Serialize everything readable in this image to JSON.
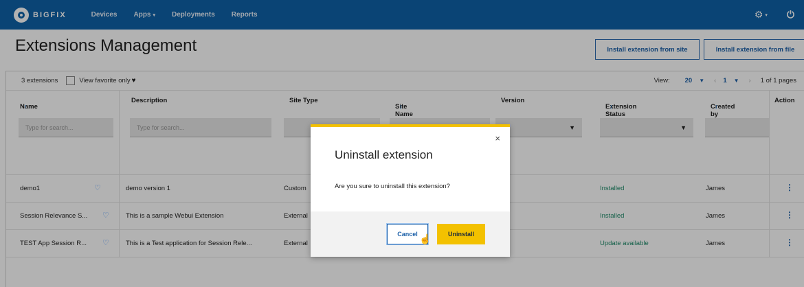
{
  "nav": {
    "brand": "BIGFIX",
    "items": [
      "Devices",
      "Apps",
      "Deployments",
      "Reports"
    ],
    "apps_caret": "▾",
    "gear_caret": "▾"
  },
  "page": {
    "title": "Extensions Management",
    "install_site_label": "Install extension from site",
    "install_file_label": "Install extension from file"
  },
  "toolbar": {
    "count": "3 extensions",
    "favorite_label": "View favorite only",
    "view_label": "View:",
    "view_value": "20",
    "page_value": "1",
    "pages_label": "1 of 1 pages"
  },
  "columns": [
    "Name",
    "Description",
    "Site Type",
    "Site Name",
    "Version",
    "Extension Status",
    "Created by",
    "Action"
  ],
  "filters": {
    "name_placeholder": "Type for search...",
    "description_placeholder": "Type for search..."
  },
  "rows": [
    {
      "name": "demo1",
      "description": "demo version 1",
      "site_type": "Custom",
      "status": "Installed",
      "created_by": "James"
    },
    {
      "name": "Session Relevance S...",
      "description": "This is a sample Webui Extension",
      "site_type": "External",
      "status": "Installed",
      "created_by": "James"
    },
    {
      "name": "TEST App Session R...",
      "description": "This is a Test application for Session Rele...",
      "site_type": "External",
      "status": "Update available",
      "created_by": "James"
    }
  ],
  "modal": {
    "title": "Uninstall extension",
    "message": "Are you sure to uninstall this extension?",
    "cancel_label": "Cancel",
    "uninstall_label": "Uninstall",
    "close_glyph": "×"
  },
  "colors": {
    "nav_bg": "#0f62a8",
    "accent": "#f3c100",
    "status_green": "#1f8b6a",
    "link_blue": "#1b5fa8"
  }
}
